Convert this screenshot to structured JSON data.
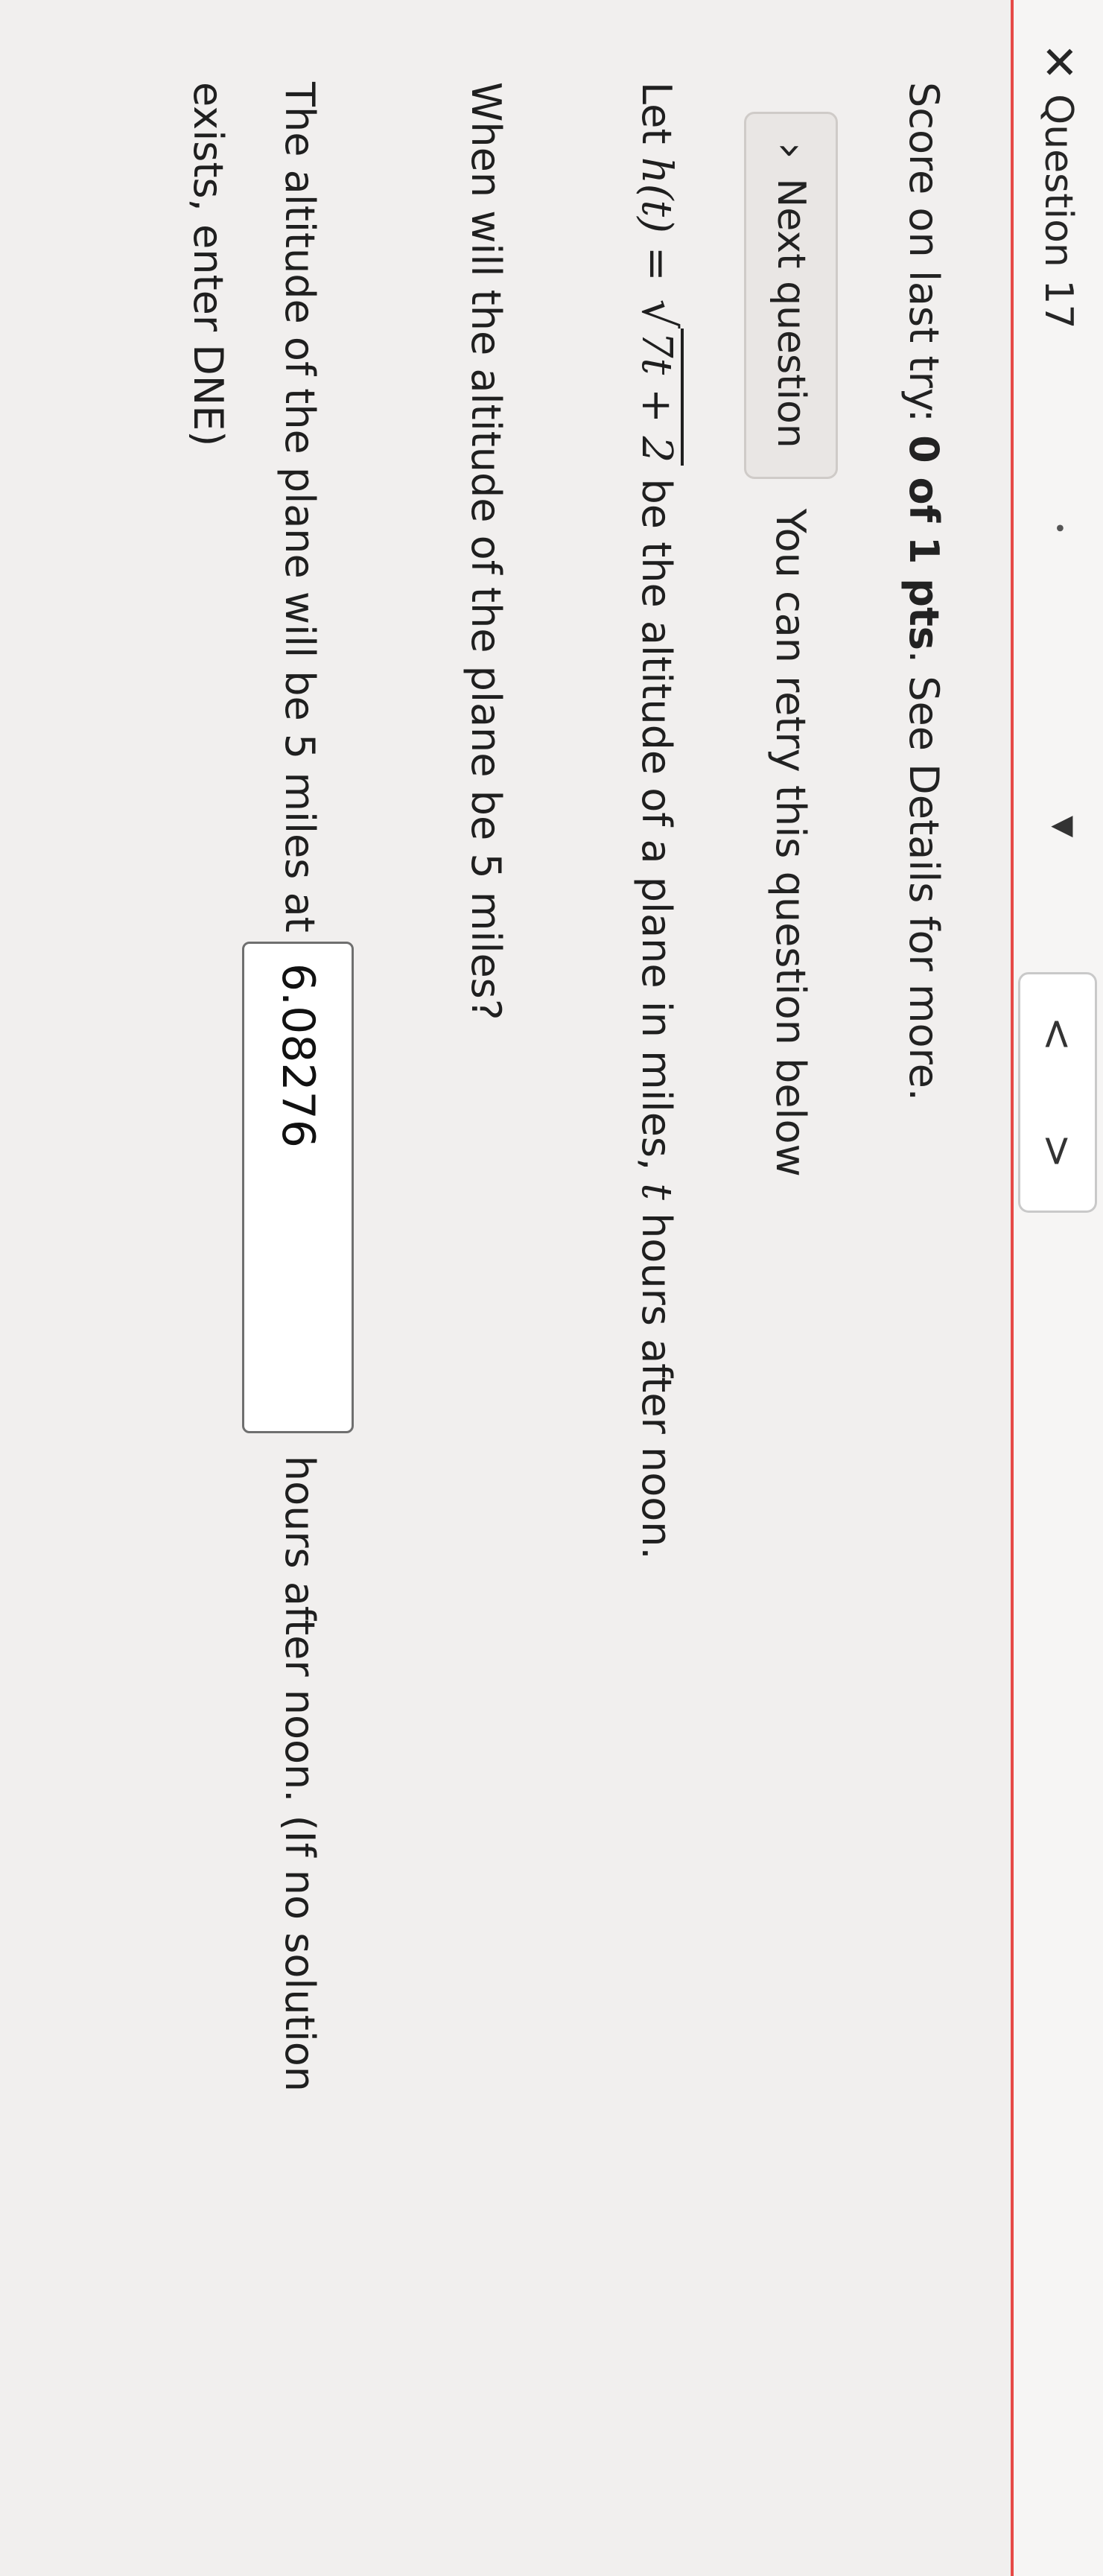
{
  "question_bar": {
    "title": "Question 17",
    "prev_icon": "chevron-left-icon",
    "next_icon": "chevron-right-icon"
  },
  "score": {
    "prefix": "Score on last try: ",
    "value": "0 of 1 pts",
    "suffix": ". See Details for more."
  },
  "retry": {
    "next_button": "Next question",
    "message": "You can retry this question below"
  },
  "problem": {
    "intro_before": "Let ",
    "func": "h(t)",
    "equals": " = ",
    "radicand": "7t + 2",
    "intro_after": " be the altitude of a plane in miles, ",
    "var": "t",
    "intro_end": " hours after noon.",
    "question": "When will the altitude of the plane be 5 miles?"
  },
  "answer": {
    "before": "The altitude of the plane will be 5 miles at",
    "value": "6.08276",
    "after": "hours after noon. (If no solution",
    "line2": "exists, enter DNE)"
  },
  "colors": {
    "accent_line": "#e64a47"
  }
}
